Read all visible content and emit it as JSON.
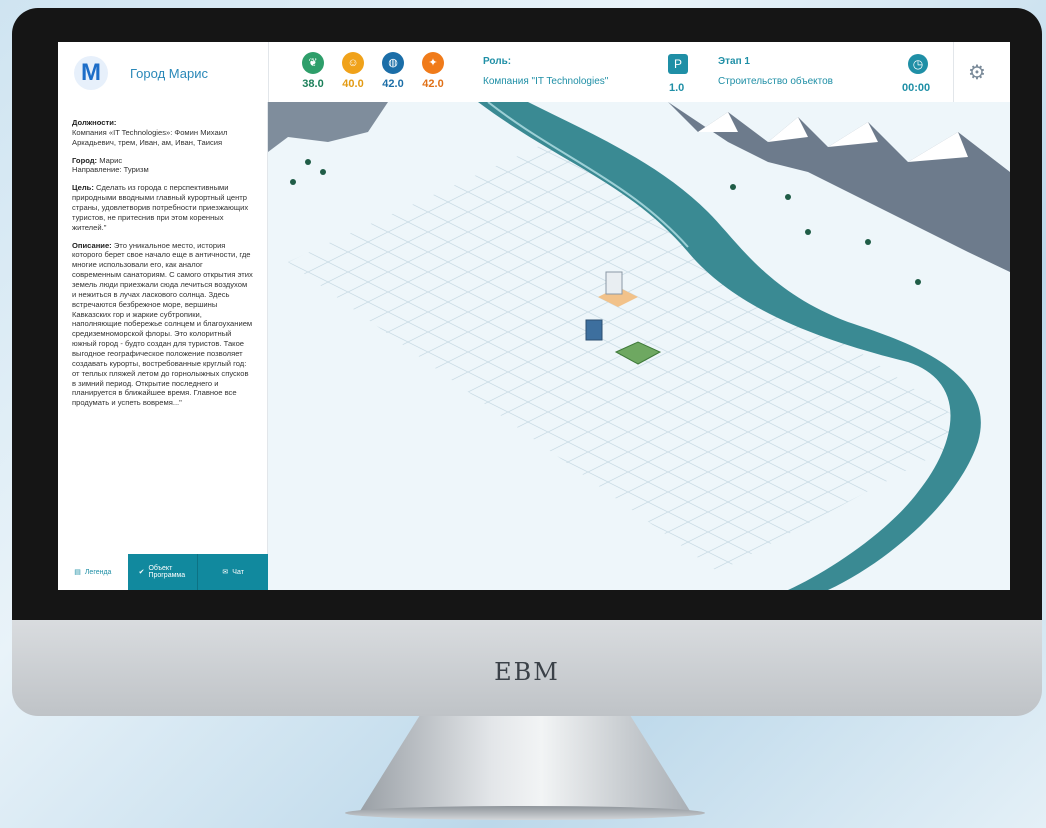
{
  "brand": "EBM",
  "header": {
    "logo_letter": "M",
    "city_title": "Город Марис",
    "stats": [
      {
        "icon": "leaf-icon",
        "value": "38.0",
        "color": "#2e9e6a",
        "text_color": "#1b7f59"
      },
      {
        "icon": "people-icon",
        "value": "40.0",
        "color": "#f0a21a",
        "text_color": "#e39a12"
      },
      {
        "icon": "globe-icon",
        "value": "42.0",
        "color": "#1b6ea8",
        "text_color": "#1b6ea8"
      },
      {
        "icon": "flame-icon",
        "value": "42.0",
        "color": "#f07b1a",
        "text_color": "#e07016"
      }
    ],
    "role_label": "Роль:",
    "role_value": "Компания \"IT Technologies\"",
    "p_icon": "P",
    "p_value": "1.0",
    "stage_label": "Этап 1",
    "stage_value": "Строительство объектов",
    "timer": "00:00"
  },
  "sidebar": {
    "positions_label": "Должности:",
    "positions_text": "Компания «IT Technologies»: Фомин Михаил Аркадьевич, трем, Иван, ам, Иван, Таисия",
    "city_label": "Город:",
    "city_text": "Марис",
    "direction_text": "Направление: Туризм",
    "goal_label": "Цель:",
    "goal_text": "Сделать из города с перспективными природными вводными главный курортный центр страны, удовлетворив потребности приезжающих туристов, не притеснив при этом коренных жителей.\"",
    "desc_label": "Описание:",
    "desc_text": "Это уникальное место, история которого берет свое начало еще в античности, где многие использовали его, как аналог современным санаториям. С самого открытия этих земель люди приезжали сюда лечиться воздухом и нежиться в лучах ласкового солнца. Здесь встречаются безбрежное море, вершины Кавказских гор и жаркие субтропики, наполняющие побережье солнцем и благоуханием средиземноморской флоры. Это колоритный южный город - будто создан для туристов. Такое выгодное географическое положение позволяет создавать курорты, востребованные круглый год: от теплых пляжей летом до горнолыжных спусков в зимний период. Открытие последнего и планируется в ближайшее время. Главное все продумать и успеть вовремя...\""
  },
  "tabs": {
    "legend": "Легенда",
    "object_program": "Объект Программа",
    "chat": "Чат"
  },
  "colors": {
    "accent": "#11899e",
    "river": "#3a8a93"
  }
}
